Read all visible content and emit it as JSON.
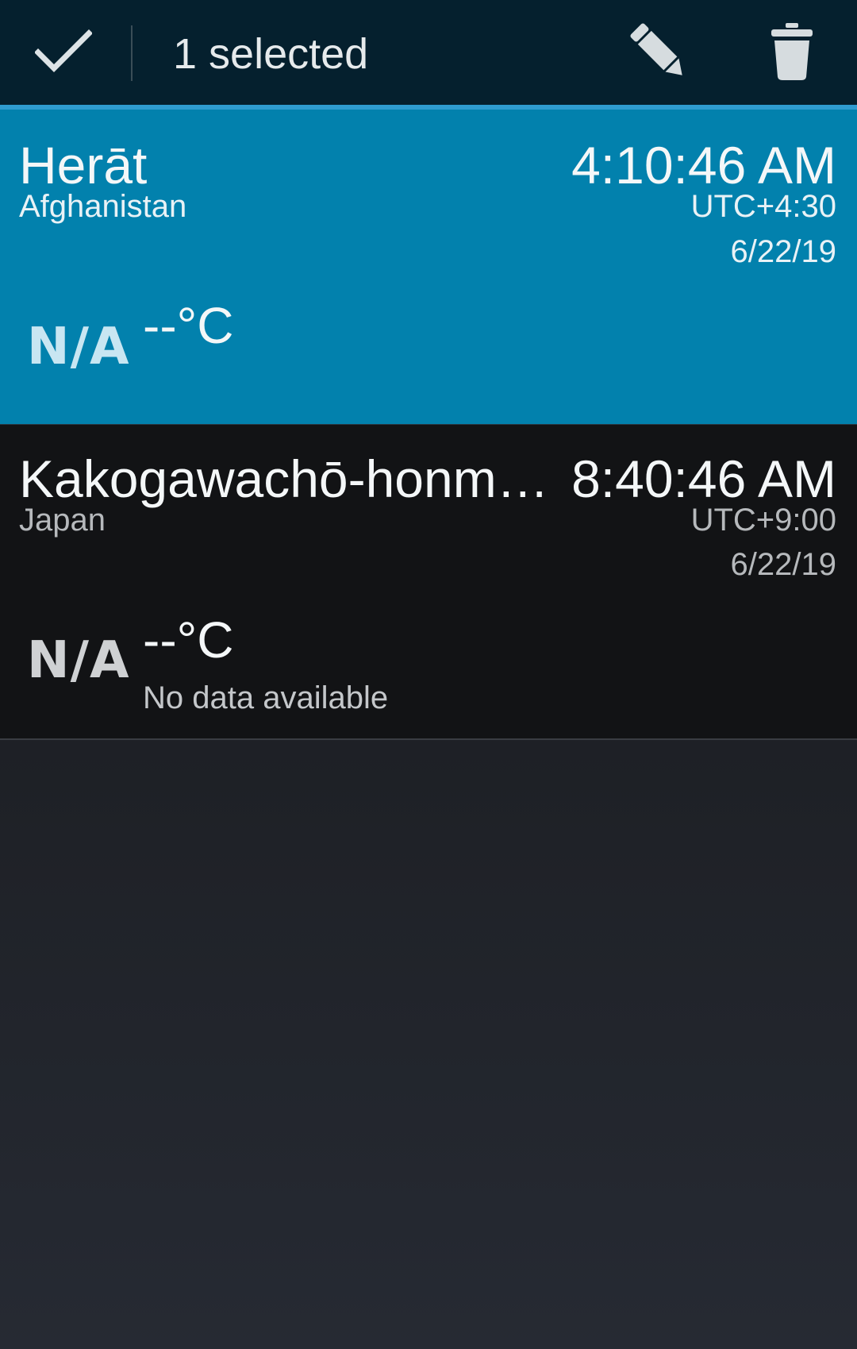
{
  "action_bar": {
    "title": "1 selected",
    "icons": {
      "done": "checkmark-icon",
      "edit": "pencil-icon",
      "delete": "trash-icon"
    },
    "colors": {
      "background": "#05202e",
      "underline": "#2f9cd0"
    }
  },
  "cities": [
    {
      "name": "Herāt",
      "country": "Afghanistan",
      "time": "4:10:46 AM",
      "timezone": "UTC+4:30",
      "date": "6/22/19",
      "weather_icon": "N/A",
      "temperature": "--°C",
      "status": "",
      "selected": true,
      "background": "#0281ad"
    },
    {
      "name": "Kakogawachō-honma…",
      "country": "Japan",
      "time": "8:40:46 AM",
      "timezone": "UTC+9:00",
      "date": "6/22/19",
      "weather_icon": "N/A",
      "temperature": "--°C",
      "status": "No data available",
      "selected": false,
      "background": "#121315"
    }
  ]
}
